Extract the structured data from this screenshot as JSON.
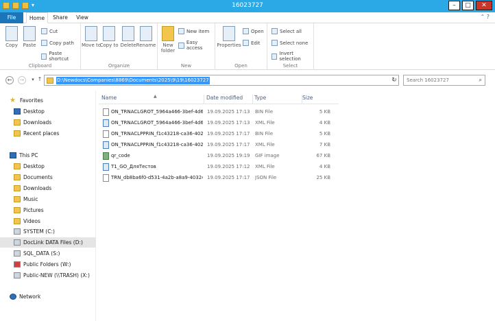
{
  "window": {
    "title": "16023727",
    "minimize_glyph": "–",
    "maximize_glyph": "□",
    "close_glyph": "✕"
  },
  "tabs": {
    "file": "File",
    "home": "Home",
    "share": "Share",
    "view": "View"
  },
  "ribbon": {
    "clipboard": {
      "label": "Clipboard",
      "copy": "Copy",
      "paste": "Paste",
      "cut": "Cut",
      "copy_path": "Copy path",
      "paste_shortcut": "Paste shortcut"
    },
    "organize": {
      "label": "Organize",
      "move_to": "Move to",
      "copy_to": "Copy to",
      "delete": "Delete",
      "rename": "Rename"
    },
    "new": {
      "label": "New",
      "new_folder": "New folder",
      "new_item": "New item",
      "easy_access": "Easy access"
    },
    "open": {
      "label": "Open",
      "properties": "Properties",
      "open": "Open",
      "edit": "Edit"
    },
    "select": {
      "label": "Select",
      "select_all": "Select all",
      "select_none": "Select none",
      "invert_selection": "Invert selection"
    }
  },
  "address": {
    "path": "D:\\Newdocs\\Companies\\8869\\Documents\\2025\\9\\19\\16023727",
    "search_placeholder": "Search 16023727"
  },
  "nav": {
    "favorites": "Favorites",
    "fav_items": [
      "Desktop",
      "Downloads",
      "Recent places"
    ],
    "this_pc": "This PC",
    "pc_items": [
      "Desktop",
      "Documents",
      "Downloads",
      "Music",
      "Pictures",
      "Videos",
      "SYSTEM (C:)",
      "DocLink DATA Files (D:)",
      "SQL_DATA (S:)",
      "Public Folders (W:)",
      "Public-NEW (\\\\TRASH) (X:)"
    ],
    "network": "Network"
  },
  "columns": {
    "name": "Name",
    "date": "Date modified",
    "type": "Type",
    "size": "Size"
  },
  "files": [
    {
      "name": "ON_TRNACLGROT_5964a466-3bef-4d67-...",
      "date": "19.09.2025 17:13",
      "type": "BIN File",
      "size": "5 KB"
    },
    {
      "name": "ON_TRNACLGROT_5964a466-3bef-4d67-...",
      "date": "19.09.2025 17:13",
      "type": "XML File",
      "size": "4 KB"
    },
    {
      "name": "ON_TRNACLPPRIN_f1c43218-ca36-4023-...",
      "date": "19.09.2025 17:17",
      "type": "BIN File",
      "size": "5 KB"
    },
    {
      "name": "ON_TRNACLPPRIN_f1c43218-ca36-4023-...",
      "date": "19.09.2025 17:17",
      "type": "XML File",
      "size": "7 KB"
    },
    {
      "name": "qr_code",
      "date": "19.09.2025 19:19",
      "type": "GIF image",
      "size": "67 KB"
    },
    {
      "name": "T1_GO_ДляТестов",
      "date": "19.09.2025 17:12",
      "type": "XML File",
      "size": "4 KB"
    },
    {
      "name": "TRN_db8ba6f0-d531-4a2b-a8a9-403241fe...",
      "date": "19.09.2025 17:17",
      "type": "JSON File",
      "size": "25 KB"
    }
  ]
}
